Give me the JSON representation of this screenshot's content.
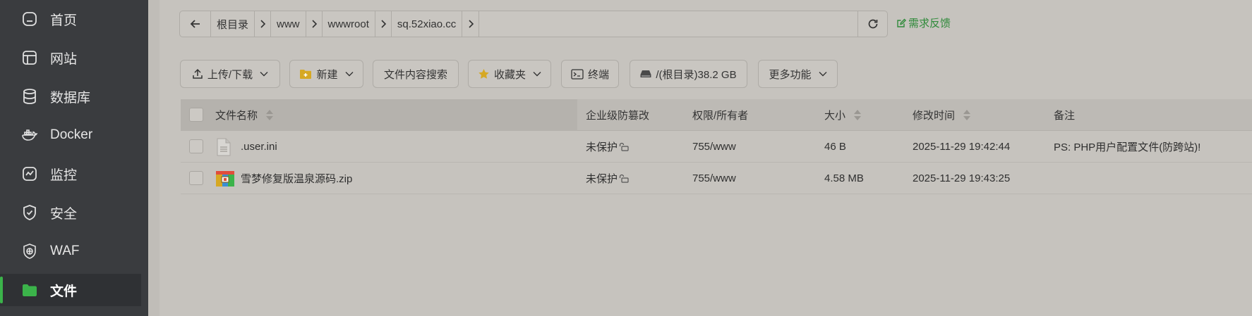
{
  "sidebar": {
    "items": [
      {
        "label": "首页",
        "icon": "home-icon"
      },
      {
        "label": "网站",
        "icon": "website-icon"
      },
      {
        "label": "数据库",
        "icon": "database-icon"
      },
      {
        "label": "Docker",
        "icon": "docker-icon"
      },
      {
        "label": "监控",
        "icon": "monitor-icon"
      },
      {
        "label": "安全",
        "icon": "shield-icon"
      },
      {
        "label": "WAF",
        "icon": "waf-icon"
      },
      {
        "label": "文件",
        "icon": "folder-icon",
        "active": true
      }
    ],
    "active_color": "#3bb34a"
  },
  "pathbar": {
    "crumbs": [
      "根目录",
      "www",
      "wwwroot",
      "sq.52xiao.cc"
    ]
  },
  "feedback": {
    "label": "需求反馈",
    "color": "#2f8a3a"
  },
  "toolbar": {
    "upload_download": "上传/下载",
    "new": "新建",
    "content_search": "文件内容搜索",
    "favorites": "收藏夹",
    "terminal": "终端",
    "disk": "/(根目录)38.2 GB",
    "more": "更多功能"
  },
  "table": {
    "headers": {
      "name": "文件名称",
      "tamper": "企业级防篡改",
      "perm": "权限/所有者",
      "size": "大小",
      "mtime": "修改时间",
      "note": "备注"
    },
    "rows": [
      {
        "name": ".user.ini",
        "icon": "text-file-icon",
        "tamper": "未保护",
        "perm": "755/www",
        "size": "46 B",
        "mtime": "2025-11-29 19:42:44",
        "note": "PS: PHP用户配置文件(防跨站)!"
      },
      {
        "name": "雪梦修复版温泉源码.zip",
        "icon": "zip-file-icon",
        "tamper": "未保护",
        "perm": "755/www",
        "size": "4.58 MB",
        "mtime": "2025-11-29 19:43:25",
        "note": ""
      }
    ]
  }
}
